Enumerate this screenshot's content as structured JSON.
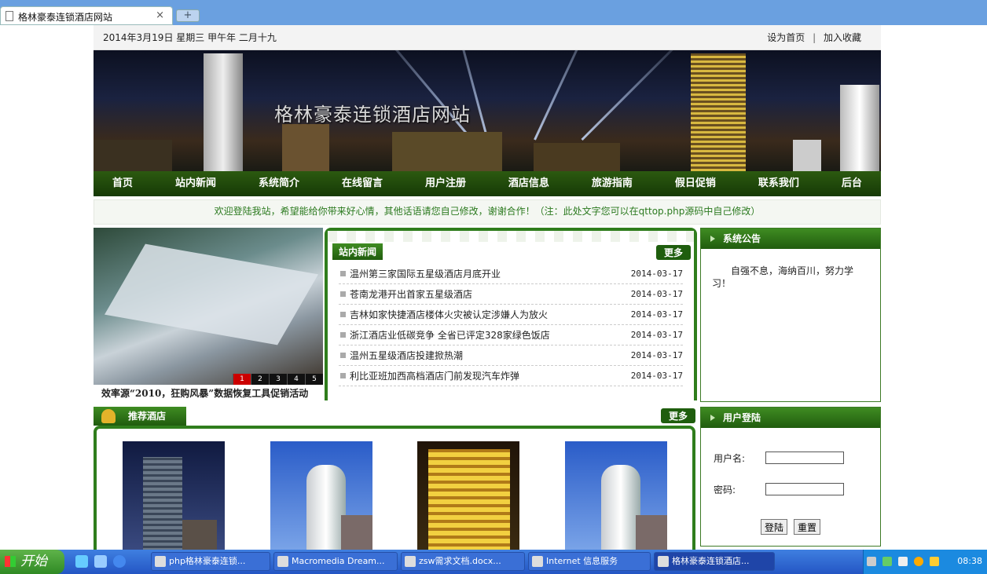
{
  "browser": {
    "tab_title": "格林豪泰连锁酒店网站",
    "close_glyph": "×",
    "newtab_glyph": "+"
  },
  "topbar": {
    "date": "2014年3月19日 星期三  甲午年  二月十九",
    "set_home": "设为首页",
    "separator": "|",
    "add_fav": "加入收藏"
  },
  "banner": {
    "title": "格林豪泰连锁酒店网站"
  },
  "nav": [
    "首页",
    "站内新闻",
    "系统简介",
    "在线留言",
    "用户注册",
    "酒店信息",
    "旅游指南",
    "假日促销",
    "联系我们",
    "后台"
  ],
  "welcome": "欢迎登陆我站，希望能给你带来好心情，其他话语请您自己修改，谢谢合作！（注：此处文字您可以在qttop.php源码中自己修改）",
  "slider": {
    "caption": "效率源“2010，狂购风暴”数据恢复工具促销活动",
    "pages": [
      "1",
      "2",
      "3",
      "4",
      "5"
    ],
    "active_page": "1"
  },
  "news": {
    "header": "站内新闻",
    "more": "更多",
    "items": [
      {
        "title": "温州第三家国际五星级酒店月底开业",
        "date": "2014-03-17"
      },
      {
        "title": "苍南龙港开出首家五星级酒店",
        "date": "2014-03-17"
      },
      {
        "title": "吉林如家快捷酒店楼体火灾被认定涉嫌人为放火",
        "date": "2014-03-17"
      },
      {
        "title": "浙江酒店业低碳竞争 全省已评定328家绿色饭店",
        "date": "2014-03-17"
      },
      {
        "title": "温州五星级酒店投建掀热潮",
        "date": "2014-03-17"
      },
      {
        "title": "利比亚班加西高档酒店门前发现汽车炸弹",
        "date": "2014-03-17"
      }
    ]
  },
  "notice": {
    "header": "系统公告",
    "text": "自强不息，海纳百川，努力学习！"
  },
  "login": {
    "header": "用户登陆",
    "username_label": "用户名:",
    "password_label": "密码:",
    "login_button": "登陆",
    "reset_button": "重置"
  },
  "recommend": {
    "header": "推荐酒店",
    "more": "更多"
  },
  "taskbar": {
    "start": "开始",
    "tasks": [
      {
        "label": "php格林豪泰连锁...",
        "active": false
      },
      {
        "label": "Macromedia Dream...",
        "active": false
      },
      {
        "label": "zsw需求文档.docx...",
        "active": false
      },
      {
        "label": "Internet 信息服务",
        "active": false
      },
      {
        "label": "格林豪泰连锁酒店...",
        "active": true
      }
    ],
    "clock": "08:38"
  }
}
